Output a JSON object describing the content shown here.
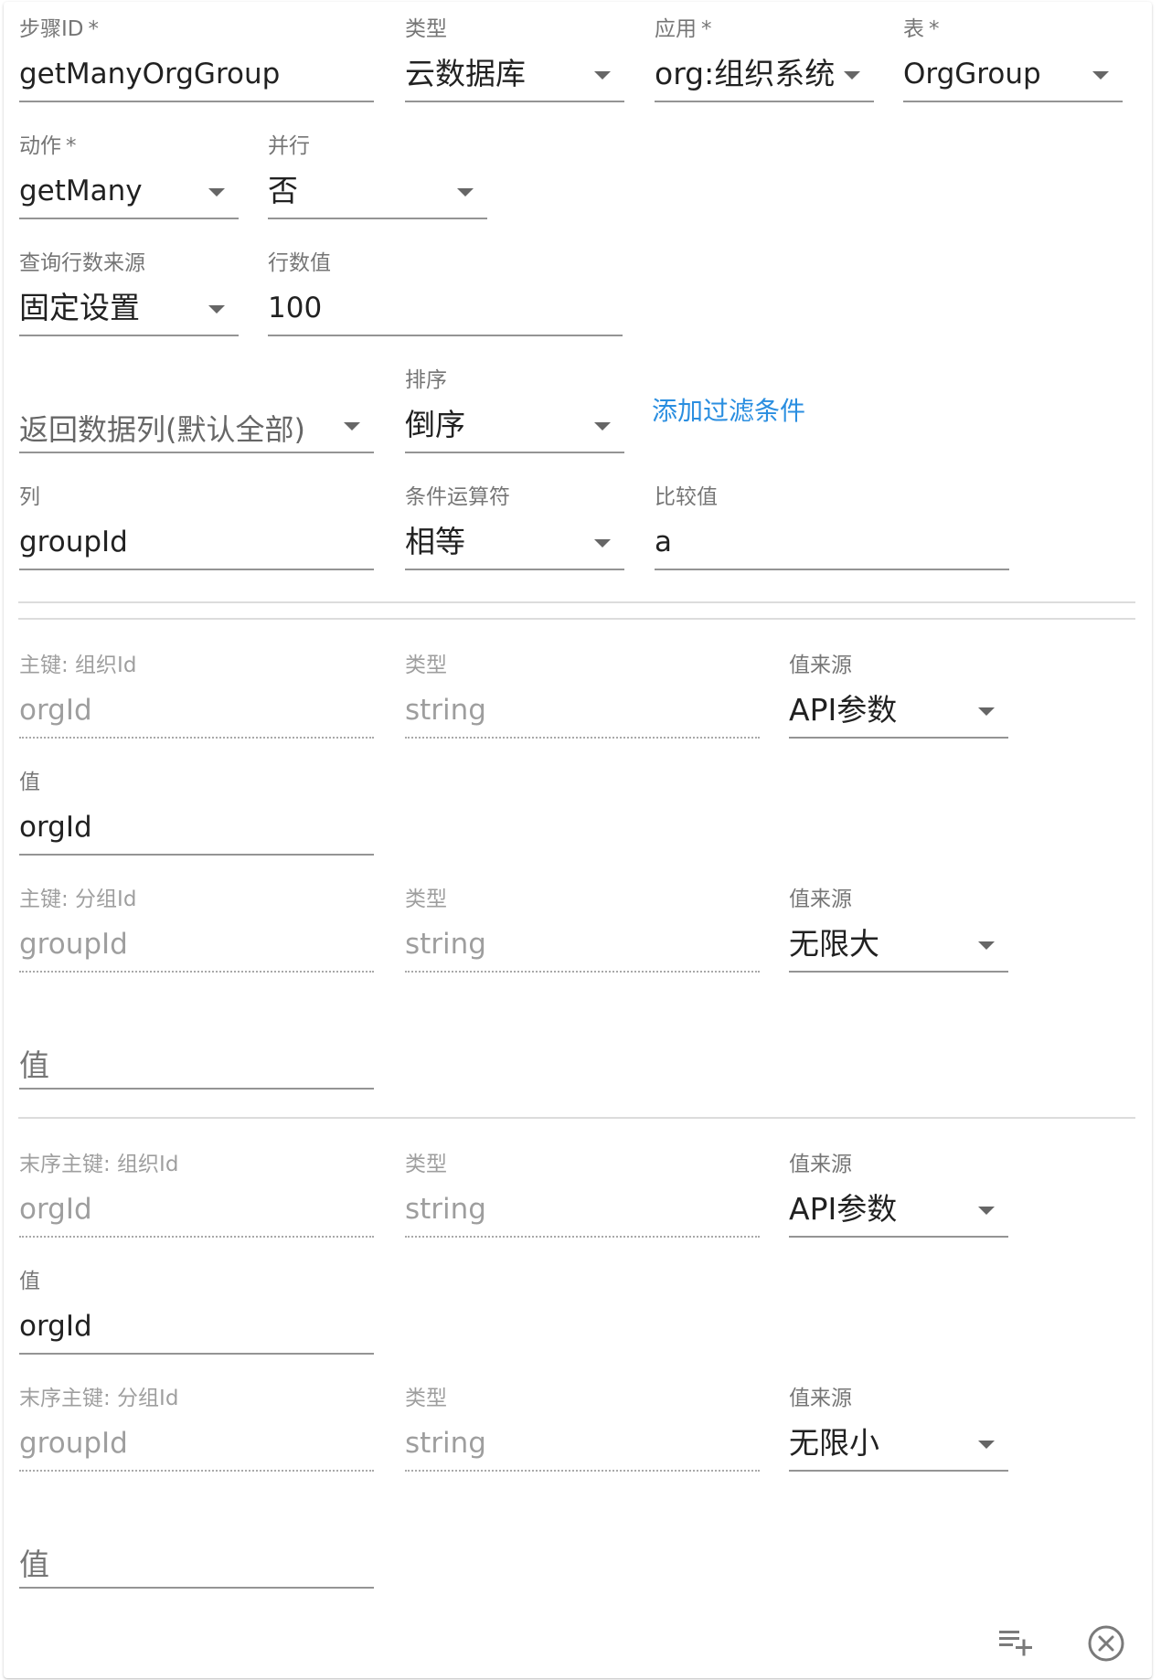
{
  "row1": {
    "step_id": {
      "label": "步骤ID",
      "required": "*",
      "value": "getManyOrgGroup"
    },
    "type": {
      "label": "类型",
      "value": "云数据库"
    },
    "app": {
      "label": "应用",
      "required": "*",
      "value": "org:组织系统"
    },
    "table": {
      "label": "表",
      "required": "*",
      "value": "OrgGroup"
    }
  },
  "row2": {
    "action": {
      "label": "动作",
      "required": "*",
      "value": "getMany"
    },
    "parallel": {
      "label": "并行",
      "value": "否"
    }
  },
  "row3": {
    "row_count_source": {
      "label": "查询行数来源",
      "value": "固定设置"
    },
    "row_count_value": {
      "label": "行数值",
      "value": "100"
    }
  },
  "row4": {
    "return_columns": {
      "placeholder": "返回数据列(默认全部)"
    },
    "sort": {
      "label": "排序",
      "value": "倒序"
    },
    "add_filter_link": "添加过滤条件"
  },
  "filter": {
    "column": {
      "label": "列",
      "value": "groupId"
    },
    "operator": {
      "label": "条件运算符",
      "value": "相等"
    },
    "compare_value": {
      "label": "比较值",
      "value": "a"
    }
  },
  "primary_key_section": {
    "key1": {
      "name_label": "主键: 组织Id",
      "name_value": "orgId",
      "type_label": "类型",
      "type_value": "string",
      "source_label": "值来源",
      "source_value": "API参数",
      "value_label": "值",
      "value_value": "orgId"
    },
    "key2": {
      "name_label": "主键: 分组Id",
      "name_value": "groupId",
      "type_label": "类型",
      "type_value": "string",
      "source_label": "值来源",
      "source_value": "无限大",
      "value_placeholder": "值"
    }
  },
  "end_key_section": {
    "key1": {
      "name_label": "末序主键: 组织Id",
      "name_value": "orgId",
      "type_label": "类型",
      "type_value": "string",
      "source_label": "值来源",
      "source_value": "API参数",
      "value_label": "值",
      "value_value": "orgId"
    },
    "key2": {
      "name_label": "末序主键: 分组Id",
      "name_value": "groupId",
      "type_label": "类型",
      "type_value": "string",
      "source_label": "值来源",
      "source_value": "无限小",
      "value_placeholder": "值"
    }
  },
  "footer": {
    "add_list_icon": "playlist-add-icon",
    "close_icon": "close-circle-icon"
  },
  "colors": {
    "link": "#2a8ee0",
    "underline": "#949494",
    "divider": "#dcdcdc"
  }
}
